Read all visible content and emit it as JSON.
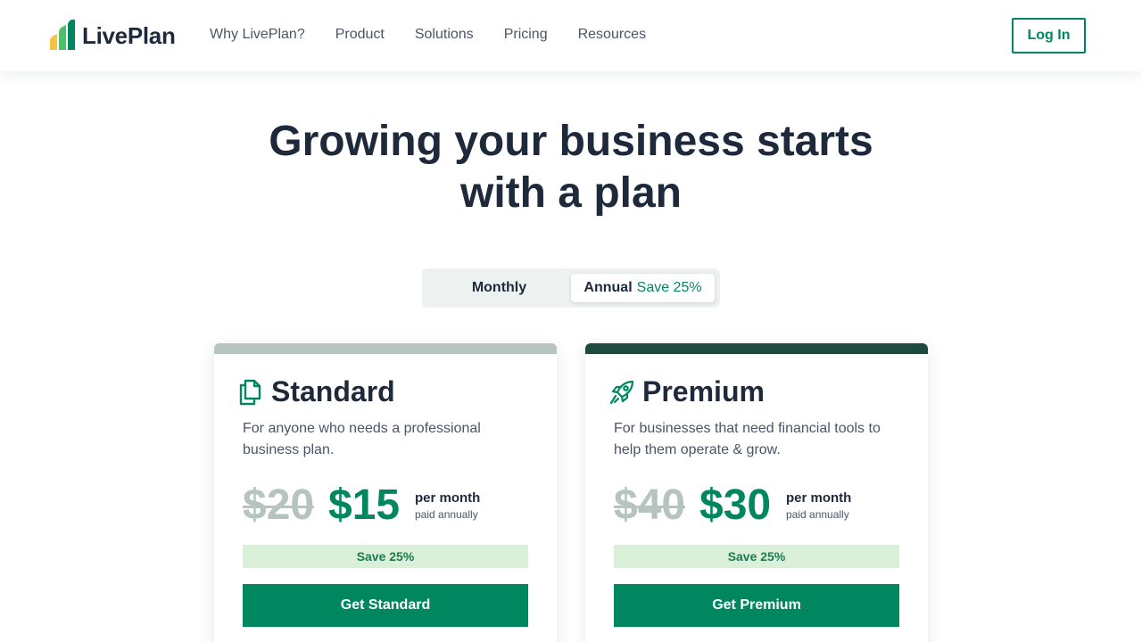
{
  "nav": {
    "logo_text": "LivePlan",
    "links": [
      "Why LivePlan?",
      "Product",
      "Solutions",
      "Pricing",
      "Resources"
    ],
    "login_label": "Log In"
  },
  "hero": {
    "headline_line1": "Growing your business starts",
    "headline_line2": "with a plan"
  },
  "billing_toggle": {
    "monthly_label": "Monthly",
    "annual_label": "Annual",
    "annual_save_label": "Save 25%",
    "selected": "Annual"
  },
  "plans": [
    {
      "name": "Standard",
      "icon": "documents-icon",
      "description": "For anyone who needs a professional business plan.",
      "old_price": "$20",
      "new_price": "$15",
      "period": "per month",
      "billing_note": "paid annually",
      "save_badge": "Save 25%",
      "cta_label": "Get Standard"
    },
    {
      "name": "Premium",
      "icon": "rocket-icon",
      "description": "For businesses that need financial tools to help them operate & grow.",
      "old_price": "$40",
      "new_price": "$30",
      "period": "per month",
      "billing_note": "paid annually",
      "save_badge": "Save 25%",
      "cta_label": "Get Premium"
    }
  ],
  "colors": {
    "brand_green": "#00875f",
    "dark_text": "#1e2a3b",
    "standard_bar": "#b5c4be",
    "premium_bar": "#1f4a3d",
    "save_badge_bg": "#daf0d8"
  }
}
